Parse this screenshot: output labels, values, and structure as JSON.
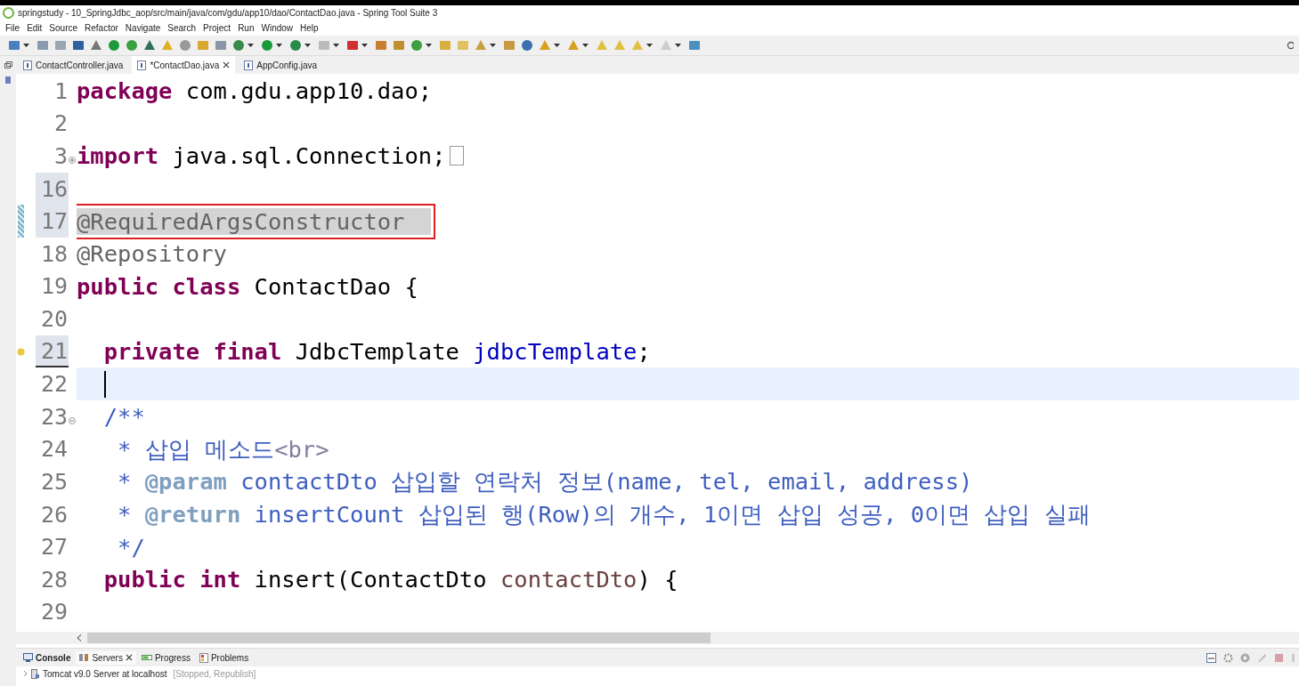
{
  "window": {
    "title": "springstudy - 10_SpringJdbc_aop/src/main/java/com/gdu/app10/dao/ContactDao.java - Spring Tool Suite 3"
  },
  "menu": [
    "File",
    "Edit",
    "Source",
    "Refactor",
    "Navigate",
    "Search",
    "Project",
    "Run",
    "Window",
    "Help"
  ],
  "editor_tabs": [
    {
      "label": "ContactController.java",
      "selected": false
    },
    {
      "label": "*ContactDao.java",
      "selected": true
    },
    {
      "label": "AppConfig.java",
      "selected": false
    }
  ],
  "lines": [
    {
      "number": "1",
      "tokens": [
        {
          "kind": "keyword",
          "text": "package"
        },
        {
          "kind": "plain",
          "text": " com.gdu.app10.dao;"
        }
      ]
    },
    {
      "number": "2"
    },
    {
      "number": "3",
      "folded": true,
      "tokens": [
        {
          "kind": "keyword",
          "text": "import"
        },
        {
          "kind": "plain",
          "text": " java.sql.Connection;"
        }
      ]
    },
    {
      "number": "16",
      "ruler_mark": true
    },
    {
      "number": "17",
      "ruler_mark": true,
      "changed": true,
      "occurrence": true,
      "boxed": true,
      "tokens": [
        {
          "kind": "annotation",
          "text": "@RequiredArgsConstructor"
        }
      ]
    },
    {
      "number": "18",
      "tokens": [
        {
          "kind": "annotation",
          "text": "@Repository"
        }
      ]
    },
    {
      "number": "19",
      "tokens": [
        {
          "kind": "keyword",
          "text": "public class"
        },
        {
          "kind": "plain",
          "text": " ContactDao {"
        }
      ]
    },
    {
      "number": "20"
    },
    {
      "number": "21",
      "ruler_mark": true,
      "warning": true,
      "tokens": [
        {
          "kind": "keyword",
          "text": "  private final"
        },
        {
          "kind": "plain",
          "text": " JdbcTemplate "
        },
        {
          "kind": "field",
          "text": "jdbcTemplate"
        },
        {
          "kind": "plain",
          "text": ";"
        }
      ]
    },
    {
      "number": "22",
      "current": true
    },
    {
      "number": "23",
      "folded": false,
      "tokens": [
        {
          "kind": "javadoc",
          "text": "  /**"
        }
      ]
    },
    {
      "number": "24",
      "tokens": [
        {
          "kind": "javadoc",
          "text": "   * 삽입 메소드"
        },
        {
          "kind": "javadoc-html",
          "text": "<br>"
        }
      ]
    },
    {
      "number": "25",
      "tokens": [
        {
          "kind": "javadoc",
          "text": "   * "
        },
        {
          "kind": "javadoc-tag",
          "text": "@param"
        },
        {
          "kind": "javadoc",
          "text": " contactDto 삽입할 연락처 정보(name, tel, email, address)"
        }
      ]
    },
    {
      "number": "26",
      "tokens": [
        {
          "kind": "javadoc",
          "text": "   * "
        },
        {
          "kind": "javadoc-tag",
          "text": "@return"
        },
        {
          "kind": "javadoc",
          "text": " insertCount 삽입된 행(Row)의 개수, 1이면 삽입 성공, 0이면 삽입 실패"
        }
      ]
    },
    {
      "number": "27",
      "tokens": [
        {
          "kind": "javadoc",
          "text": "   */"
        }
      ]
    },
    {
      "number": "28",
      "tokens": [
        {
          "kind": "keyword",
          "text": "  public int"
        },
        {
          "kind": "plain",
          "text": " insert(ContactDto "
        },
        {
          "kind": "parameter",
          "text": "contactDto"
        },
        {
          "kind": "plain",
          "text": ") {"
        }
      ]
    },
    {
      "number": "29"
    }
  ],
  "panel_tabs": [
    {
      "kind": "console",
      "label": "Console",
      "selected": false,
      "bold": true
    },
    {
      "kind": "servers",
      "label": "Servers",
      "selected": true,
      "bold": false
    },
    {
      "kind": "progress",
      "label": "Progress",
      "selected": false,
      "bold": false
    },
    {
      "kind": "problems",
      "label": "Problems",
      "selected": false,
      "bold": false
    }
  ],
  "servers": [
    {
      "name": "Tomcat v9.0 Server at localhost",
      "status": "[Stopped, Republish]"
    }
  ]
}
